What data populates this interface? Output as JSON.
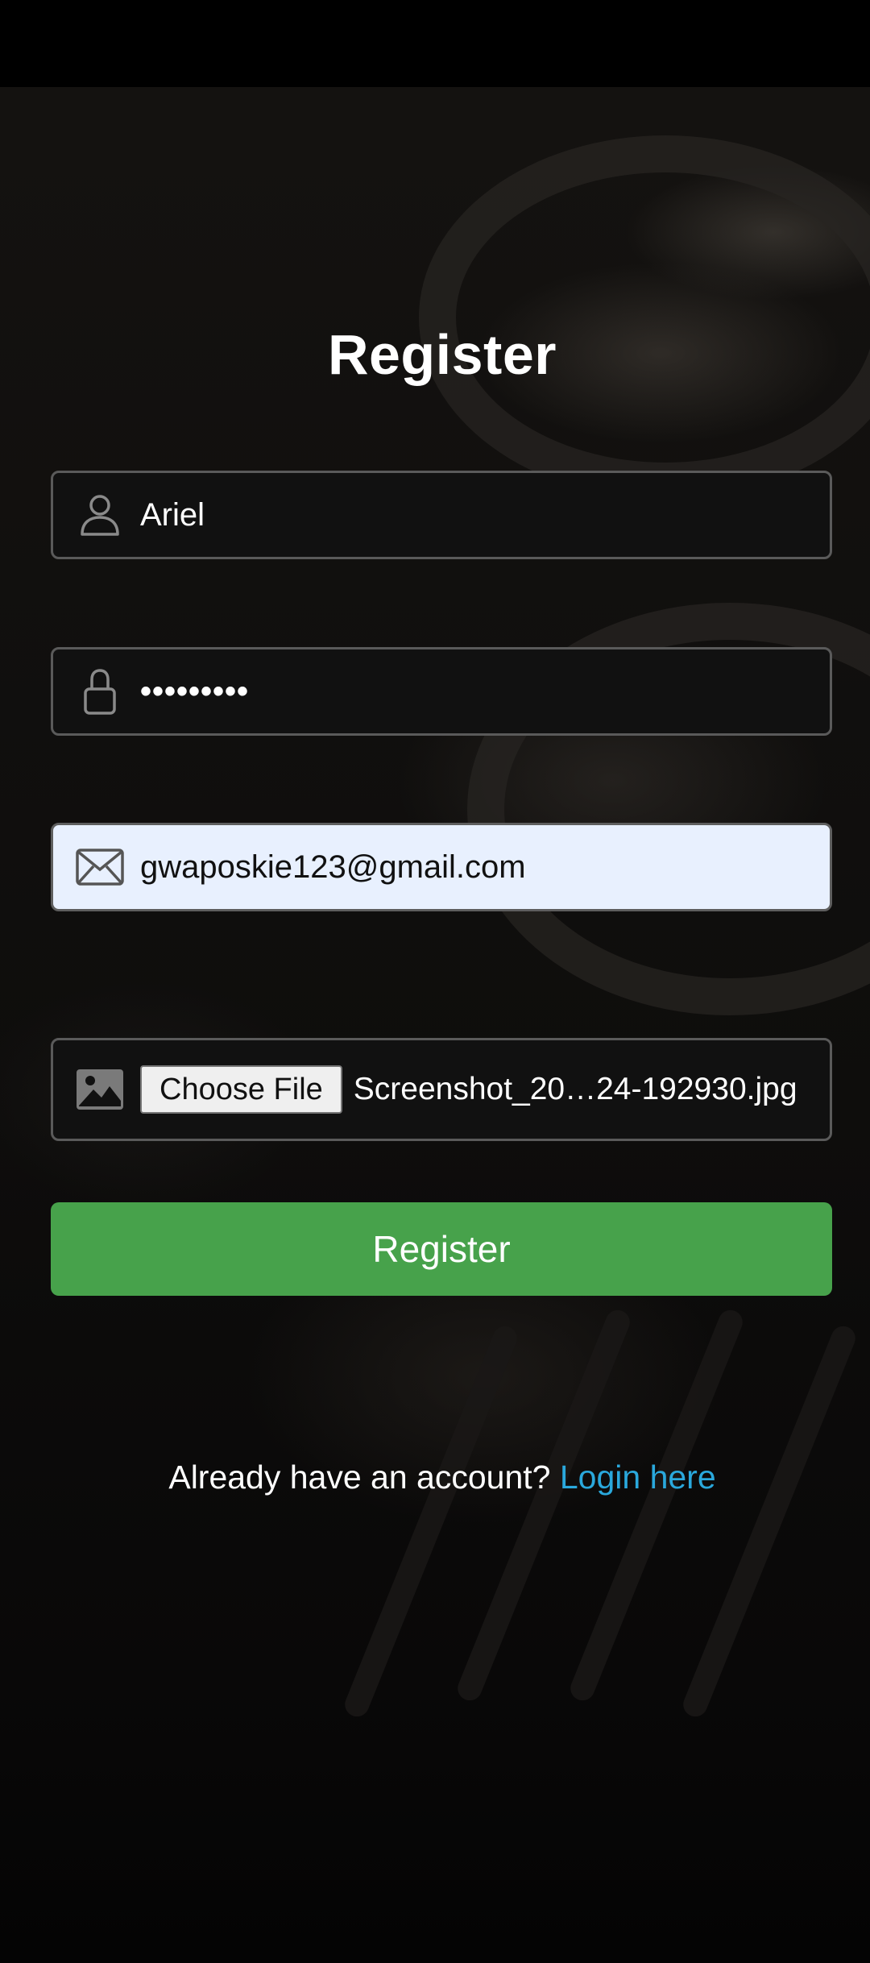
{
  "page": {
    "title": "Register"
  },
  "form": {
    "username": {
      "icon": "user-icon",
      "value": "Ariel"
    },
    "password": {
      "icon": "lock-icon",
      "value": "•••••••••"
    },
    "email": {
      "icon": "mail-icon",
      "value": "gwaposkie123@gmail.com"
    },
    "profile_image": {
      "icon": "image-icon",
      "button_label": "Choose File",
      "file_name": "Screenshot_20…24-192930.jpg"
    },
    "submit_label": "Register"
  },
  "footer": {
    "prompt": "Already have an account?",
    "link_label": "Login here"
  },
  "colors": {
    "accent_green": "#47a24b",
    "link_blue": "#2aa8dc",
    "email_autofill_bg": "#e8f0fe"
  }
}
